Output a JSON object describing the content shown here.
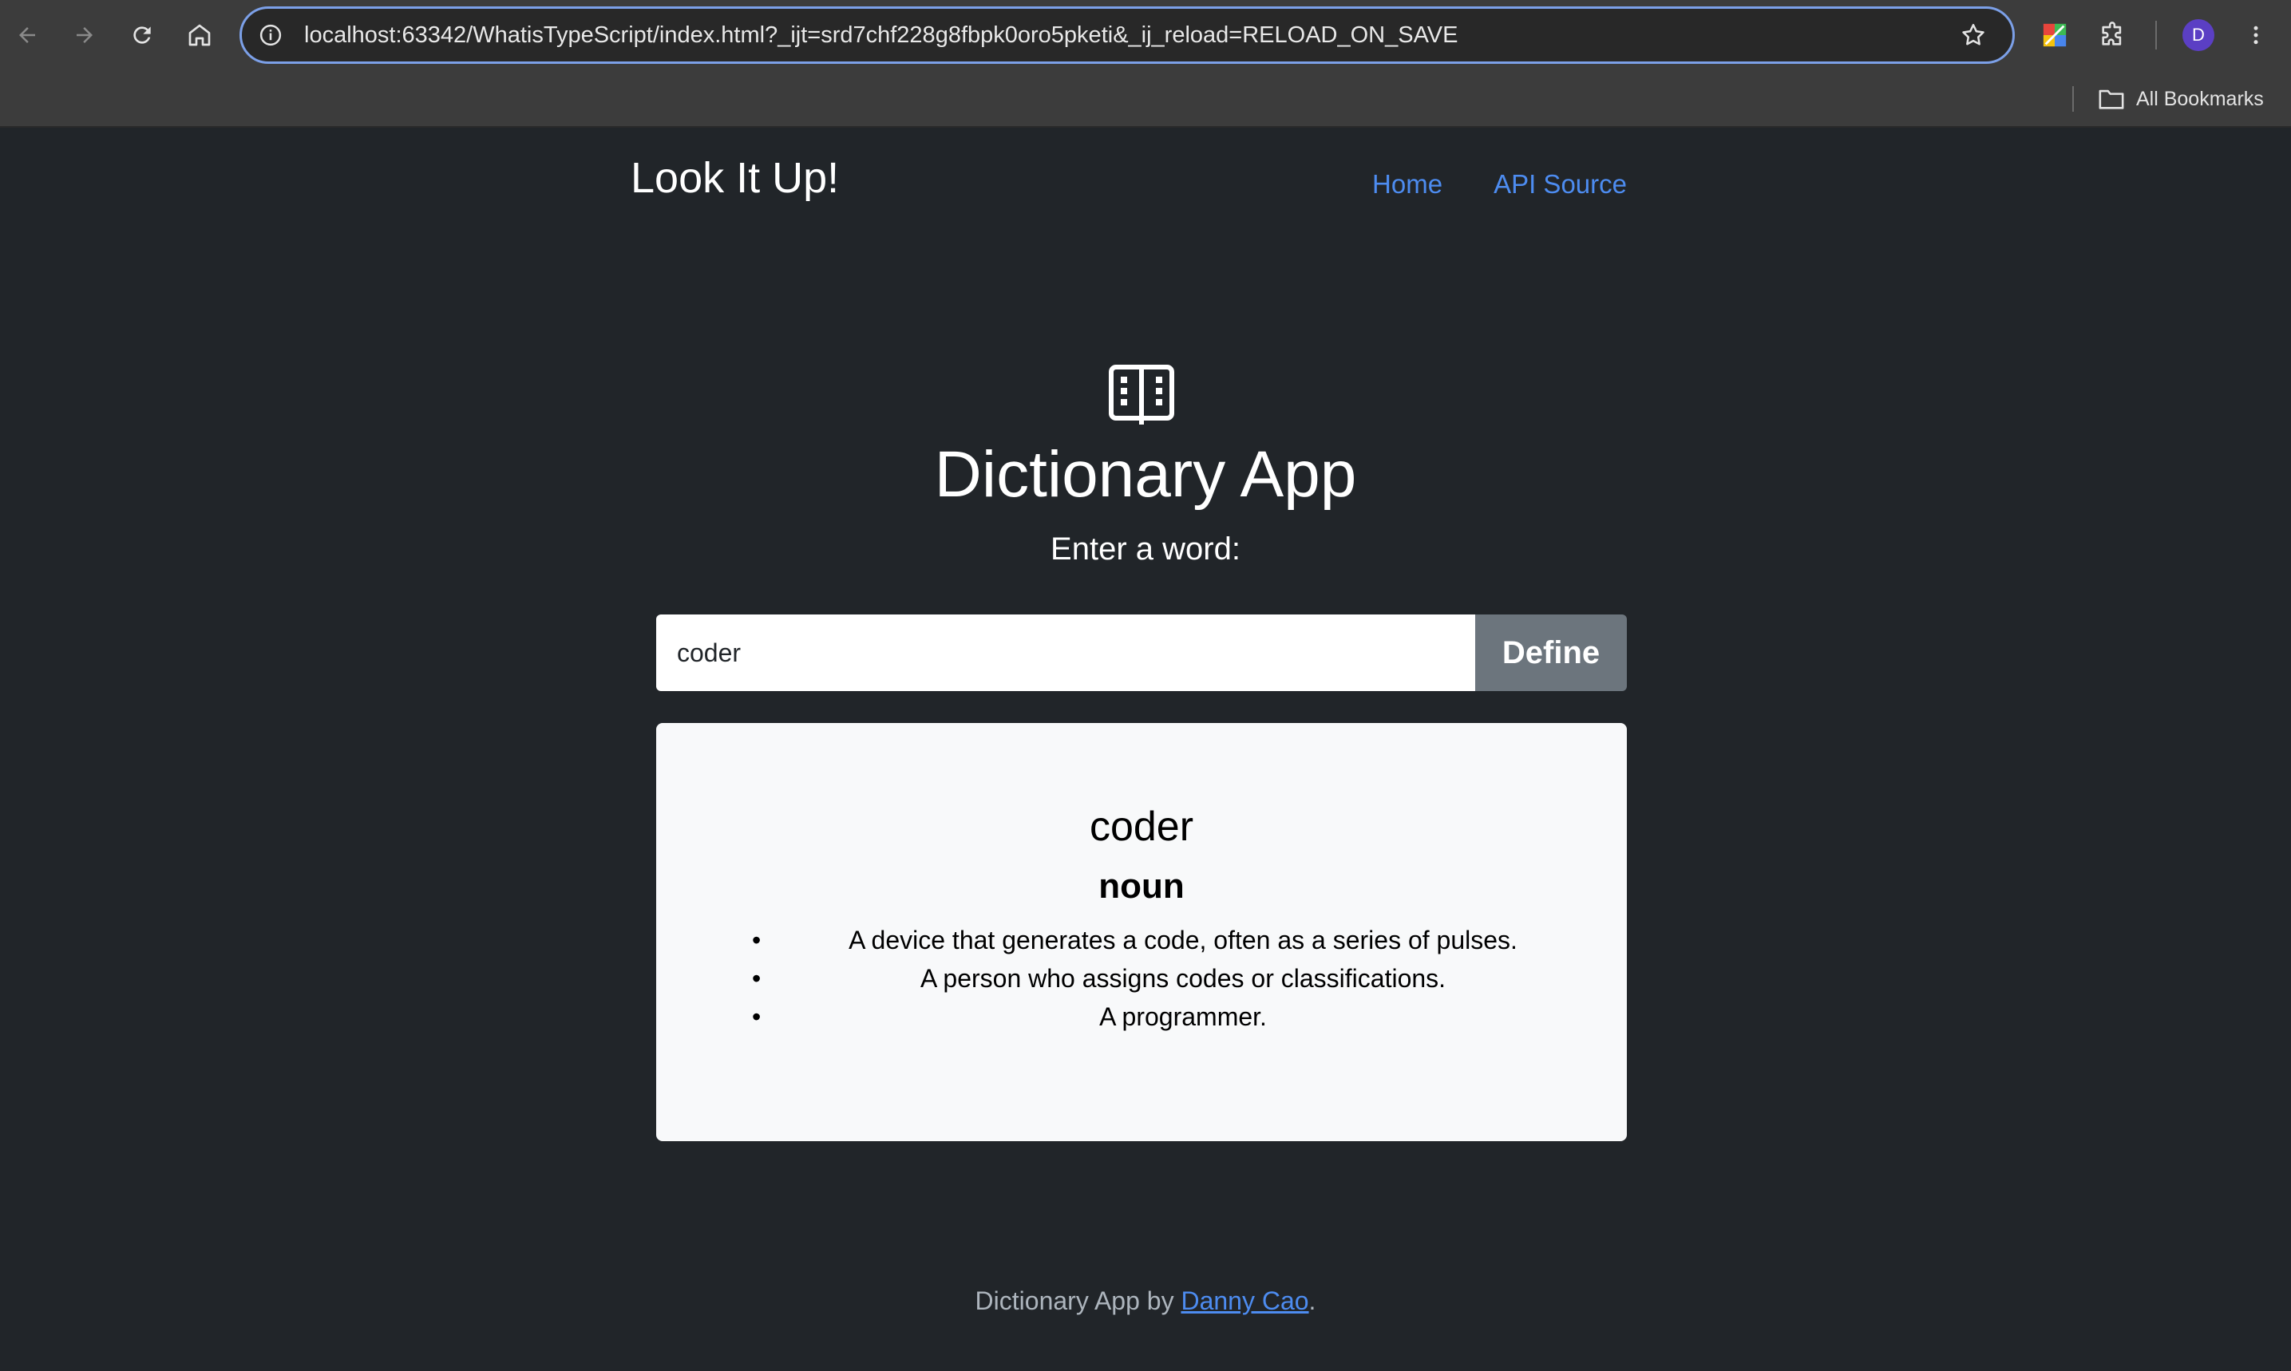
{
  "browser": {
    "url": "localhost:63342/WhatisTypeScript/index.html?_ijt=srd7chf228g8fbpk0oro5pketi&_ij_reload=RELOAD_ON_SAVE",
    "bookmarks_label": "All Bookmarks",
    "profile_initial": "D",
    "icons": [
      "back-icon",
      "forward-icon",
      "reload-icon",
      "home-icon",
      "site-info-icon",
      "star-icon",
      "extension-colorful-icon",
      "puzzle-icon",
      "kebab-menu-icon",
      "folder-icon"
    ]
  },
  "navbar": {
    "brand": "Look It Up!",
    "links": [
      {
        "label": "Home"
      },
      {
        "label": "API Source"
      }
    ]
  },
  "hero": {
    "icon": "book-icon",
    "title": "Dictionary App",
    "prompt": "Enter a word:"
  },
  "search": {
    "value": "coder",
    "placeholder": "",
    "button_label": "Define"
  },
  "result": {
    "word": "coder",
    "part_of_speech": "noun",
    "definitions": [
      "A device that generates a code, often as a series of pulses.",
      "A person who assigns codes or classifications.",
      "A programmer."
    ]
  },
  "footer": {
    "prefix": "Dictionary App by ",
    "author": "Danny Cao",
    "suffix": "."
  },
  "colors": {
    "page_bg": "#212529",
    "link": "#4d8cf0",
    "button_bg": "#6c757d",
    "card_bg": "#f8f9fa",
    "chrome_bg": "#3c3c3c"
  }
}
